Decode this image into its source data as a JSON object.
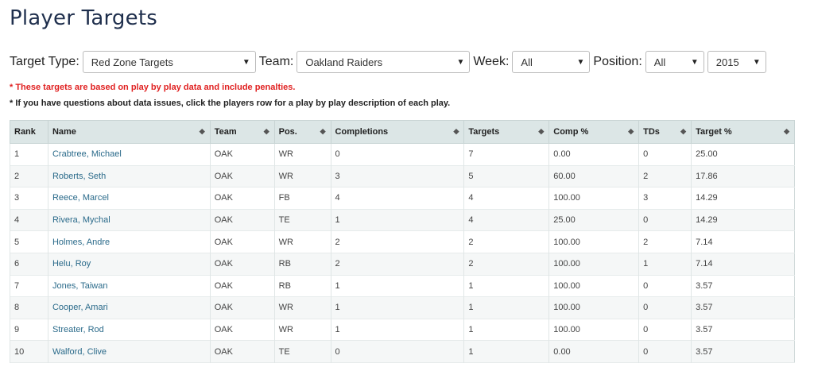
{
  "page": {
    "title": "Player Targets"
  },
  "filters": {
    "target_type_label": "Target Type:",
    "target_type_value": "Red Zone Targets",
    "team_label": "Team:",
    "team_value": "Oakland Raiders",
    "week_label": "Week:",
    "week_value": "All",
    "position_label": "Position:",
    "position_value": "All",
    "season_value": "2015"
  },
  "notes": {
    "warning": "* These targets are based on play by play data and include penalties.",
    "info": "* If you have questions about data issues, click the players row for a play by play description of each play."
  },
  "table": {
    "columns": [
      "Rank",
      "Name",
      "Team",
      "Pos.",
      "Completions",
      "Targets",
      "Comp %",
      "TDs",
      "Target %"
    ],
    "rows": [
      [
        "1",
        "Crabtree, Michael",
        "OAK",
        "WR",
        "0",
        "7",
        "0.00",
        "0",
        "25.00"
      ],
      [
        "2",
        "Roberts, Seth",
        "OAK",
        "WR",
        "3",
        "5",
        "60.00",
        "2",
        "17.86"
      ],
      [
        "3",
        "Reece, Marcel",
        "OAK",
        "FB",
        "4",
        "4",
        "100.00",
        "3",
        "14.29"
      ],
      [
        "4",
        "Rivera, Mychal",
        "OAK",
        "TE",
        "1",
        "4",
        "25.00",
        "0",
        "14.29"
      ],
      [
        "5",
        "Holmes, Andre",
        "OAK",
        "WR",
        "2",
        "2",
        "100.00",
        "2",
        "7.14"
      ],
      [
        "6",
        "Helu, Roy",
        "OAK",
        "RB",
        "2",
        "2",
        "100.00",
        "1",
        "7.14"
      ],
      [
        "7",
        "Jones, Taiwan",
        "OAK",
        "RB",
        "1",
        "1",
        "100.00",
        "0",
        "3.57"
      ],
      [
        "8",
        "Cooper, Amari",
        "OAK",
        "WR",
        "1",
        "1",
        "100.00",
        "0",
        "3.57"
      ],
      [
        "9",
        "Streater, Rod",
        "OAK",
        "WR",
        "1",
        "1",
        "100.00",
        "0",
        "3.57"
      ],
      [
        "10",
        "Walford, Clive",
        "OAK",
        "TE",
        "0",
        "1",
        "0.00",
        "0",
        "3.57"
      ]
    ]
  },
  "icons": {
    "dropdown": "caret-down-icon",
    "sort": "sort-icon"
  },
  "colors": {
    "title": "#1f2f4d",
    "warning": "#e02020",
    "link": "#2a6a8a",
    "header_bg": "#dce6e6"
  }
}
